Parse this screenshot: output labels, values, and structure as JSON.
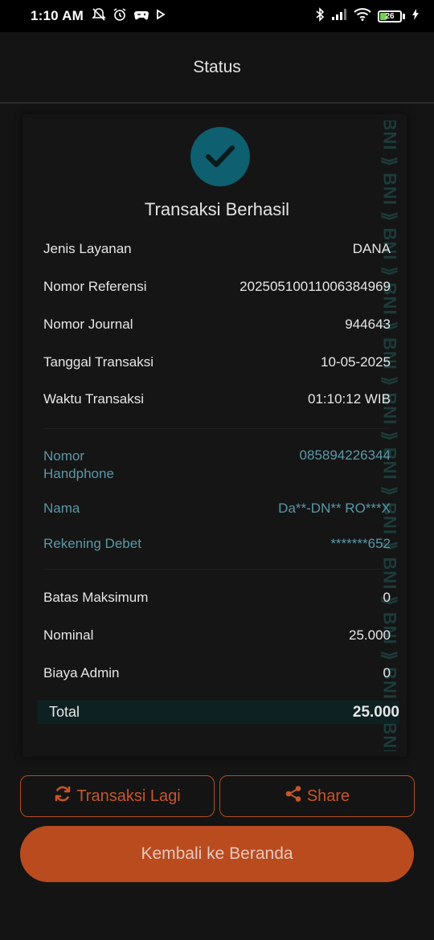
{
  "status_bar": {
    "time": "1:10 AM",
    "battery_level": "26",
    "icons": [
      "alarm-off-icon",
      "alarm-icon",
      "game-controller-icon",
      "play-icon",
      "bluetooth-icon",
      "signal-icon",
      "wifi-icon",
      "battery-icon",
      "charging-icon"
    ]
  },
  "header": {
    "title": "Status"
  },
  "receipt": {
    "success_title": "Transaksi Berhasil",
    "watermark": "BNI",
    "details": [
      {
        "label": "Jenis Layanan",
        "value": "DANA"
      },
      {
        "label": "Nomor Referensi",
        "value": "20250510011006384969"
      },
      {
        "label": "Nomor Journal",
        "value": "944643"
      },
      {
        "label": "Tanggal Transaksi",
        "value": "10-05-2025"
      },
      {
        "label": "Waktu Transaksi",
        "value": "01:10:12 WIB"
      }
    ],
    "recipient": [
      {
        "label": "Nomor Handphone",
        "value": "085894226344"
      },
      {
        "label": "Nama",
        "value": "Da**-DN** RO***X"
      },
      {
        "label": "Rekening Debet",
        "value": "*******652"
      }
    ],
    "amounts": [
      {
        "label": "Batas Maksimum",
        "value": "0"
      },
      {
        "label": "Nominal",
        "value": "25.000"
      },
      {
        "label": "Biaya Admin",
        "value": "0"
      }
    ],
    "total": {
      "label": "Total",
      "value": "25.000"
    }
  },
  "actions": {
    "repeat_label": "Transaksi Lagi",
    "share_label": "Share",
    "home_label": "Kembali ke Beranda"
  },
  "colors": {
    "accent": "#b94b1f",
    "teal": "#5a98a8",
    "check_bg": "#0e5f70",
    "background": "#141414"
  }
}
